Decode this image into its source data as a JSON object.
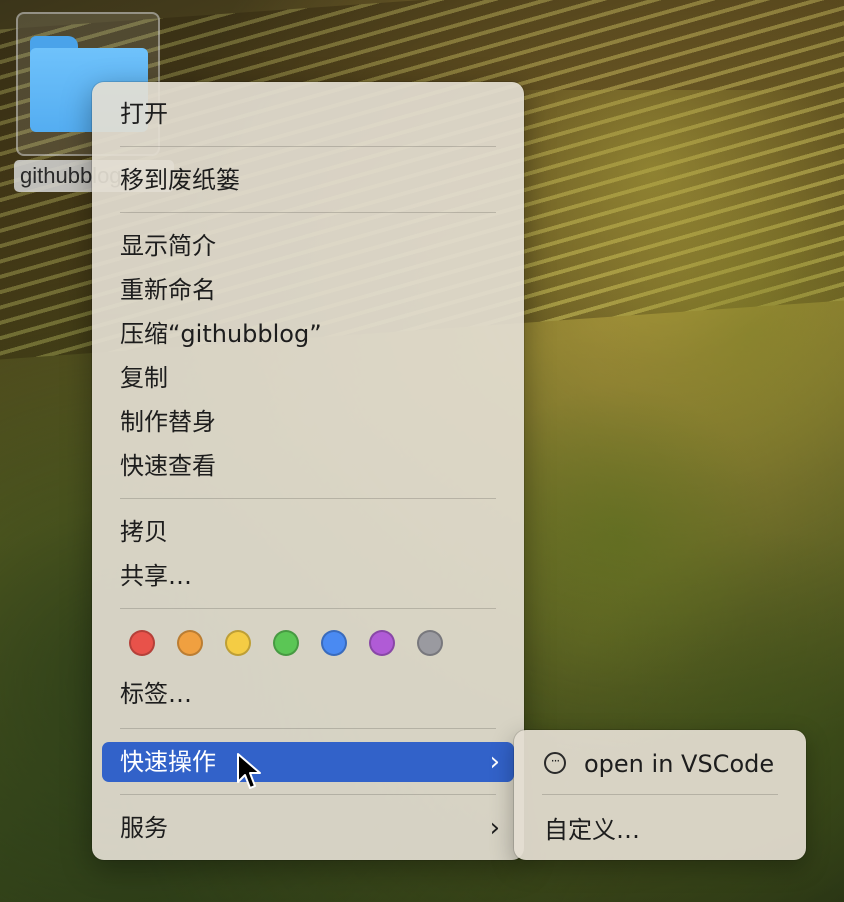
{
  "desktop": {
    "folder_label": "githubblog"
  },
  "context_menu": {
    "open": "打开",
    "move_to_trash": "移到废纸篓",
    "get_info": "显示简介",
    "rename": "重新命名",
    "compress": "压缩“githubblog”",
    "duplicate": "复制",
    "make_alias": "制作替身",
    "quick_look": "快速查看",
    "copy": "拷贝",
    "share": "共享…",
    "tags_label": "标签…",
    "tag_colors": [
      "#e8524a",
      "#f0a040",
      "#f4cc44",
      "#5bc655",
      "#4a8af2",
      "#b05bd6",
      "#9a9aa0"
    ],
    "quick_actions": "快速操作",
    "services": "服务"
  },
  "quick_actions_submenu": {
    "open_vscode": "open in VSCode",
    "customize": "自定义…"
  }
}
